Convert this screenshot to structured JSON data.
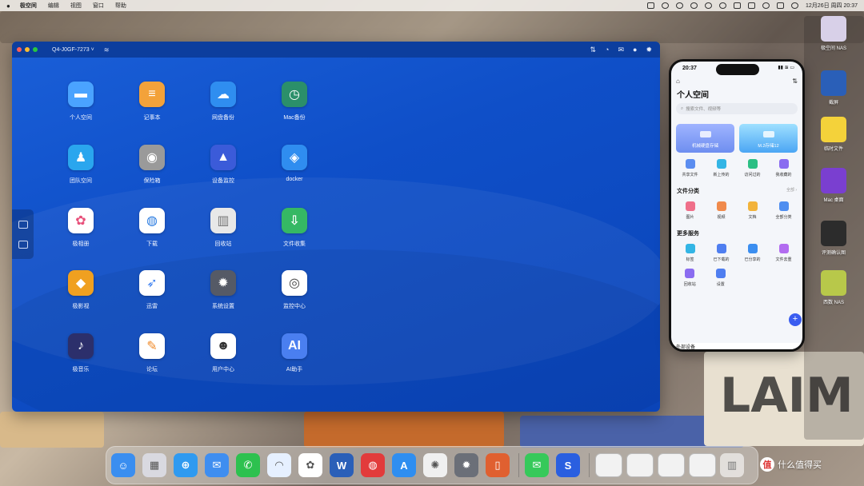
{
  "menubar": {
    "app_name": "极空间",
    "items": [
      "编辑",
      "视图",
      "窗口",
      "帮助"
    ],
    "clock": "12月26日 周四 20:37"
  },
  "window": {
    "device_name": "Q4-J0GF-7273 ˅",
    "apps": [
      {
        "label": "个人空间",
        "icon": "folder-icon",
        "color": "#4aa3ff"
      },
      {
        "label": "记事本",
        "icon": "notepad-icon",
        "color": "#f3a23a"
      },
      {
        "label": "网盘备份",
        "icon": "cloud-backup-icon",
        "color": "#2f8ef0"
      },
      {
        "label": "Mac备份",
        "icon": "time-machine-icon",
        "color": "#2b8f6a"
      },
      {
        "label": "团队空间",
        "icon": "team-folder-icon",
        "color": "#2aa6ee"
      },
      {
        "label": "保险箱",
        "icon": "safe-icon",
        "color": "#9a9a9a"
      },
      {
        "label": "设备监控",
        "icon": "monitor-chart-icon",
        "color": "#3b5bd9"
      },
      {
        "label": "docker",
        "icon": "docker-icon",
        "color": "#2f8df0"
      },
      {
        "label": "极相册",
        "icon": "photos-icon",
        "color": "#ffffff"
      },
      {
        "label": "下载",
        "icon": "globe-icon",
        "color": "#ffffff"
      },
      {
        "label": "回收站",
        "icon": "trash-icon",
        "color": "#e8e8e8"
      },
      {
        "label": "文件收集",
        "icon": "inbox-icon",
        "color": "#35b864"
      },
      {
        "label": "极影视",
        "icon": "film-icon",
        "color": "#f0a020"
      },
      {
        "label": "迅雷",
        "icon": "thunder-icon",
        "color": "#ffffff"
      },
      {
        "label": "系统设置",
        "icon": "settings-icon",
        "color": "#555a66"
      },
      {
        "label": "监控中心",
        "icon": "camera-icon",
        "color": "#ffffff"
      },
      {
        "label": "极音乐",
        "icon": "music-icon",
        "color": "#2c2f6b"
      },
      {
        "label": "论坛",
        "icon": "chat-icon",
        "color": "#ffffff"
      },
      {
        "label": "用户中心",
        "icon": "user-icon",
        "color": "#ffffff"
      },
      {
        "label": "AI助手",
        "icon": "ai-icon",
        "color": "#4a7ff0"
      }
    ],
    "ai_text": "AI"
  },
  "phone": {
    "time": "20:37",
    "title": "个人空间",
    "search_placeholder": "搜索文件、视频等",
    "cards": [
      "机械硬盘存储",
      "M.2存储12"
    ],
    "quick": [
      "共享文件",
      "新上传的",
      "访问过的",
      "我收藏的"
    ],
    "section1": "文件分类",
    "section1_more": "全部 ›",
    "categories": [
      "图片",
      "视频",
      "文档",
      "全部分类"
    ],
    "section2": "更多服务",
    "services": [
      "标签",
      "已下载的",
      "已分享的",
      "文件去重"
    ],
    "services2": [
      "回收站",
      "设置"
    ],
    "bottom": "外部设备"
  },
  "desktop": [
    {
      "label": "极空间 NAS"
    },
    {
      "label": "截屏"
    },
    {
      "label": "临时文件"
    },
    {
      "label": "Mac 桌面"
    },
    {
      "label": "评测确认图"
    },
    {
      "label": "西数 NAS"
    }
  ],
  "watermark": {
    "text": "什么值得买",
    "icon": "值"
  }
}
